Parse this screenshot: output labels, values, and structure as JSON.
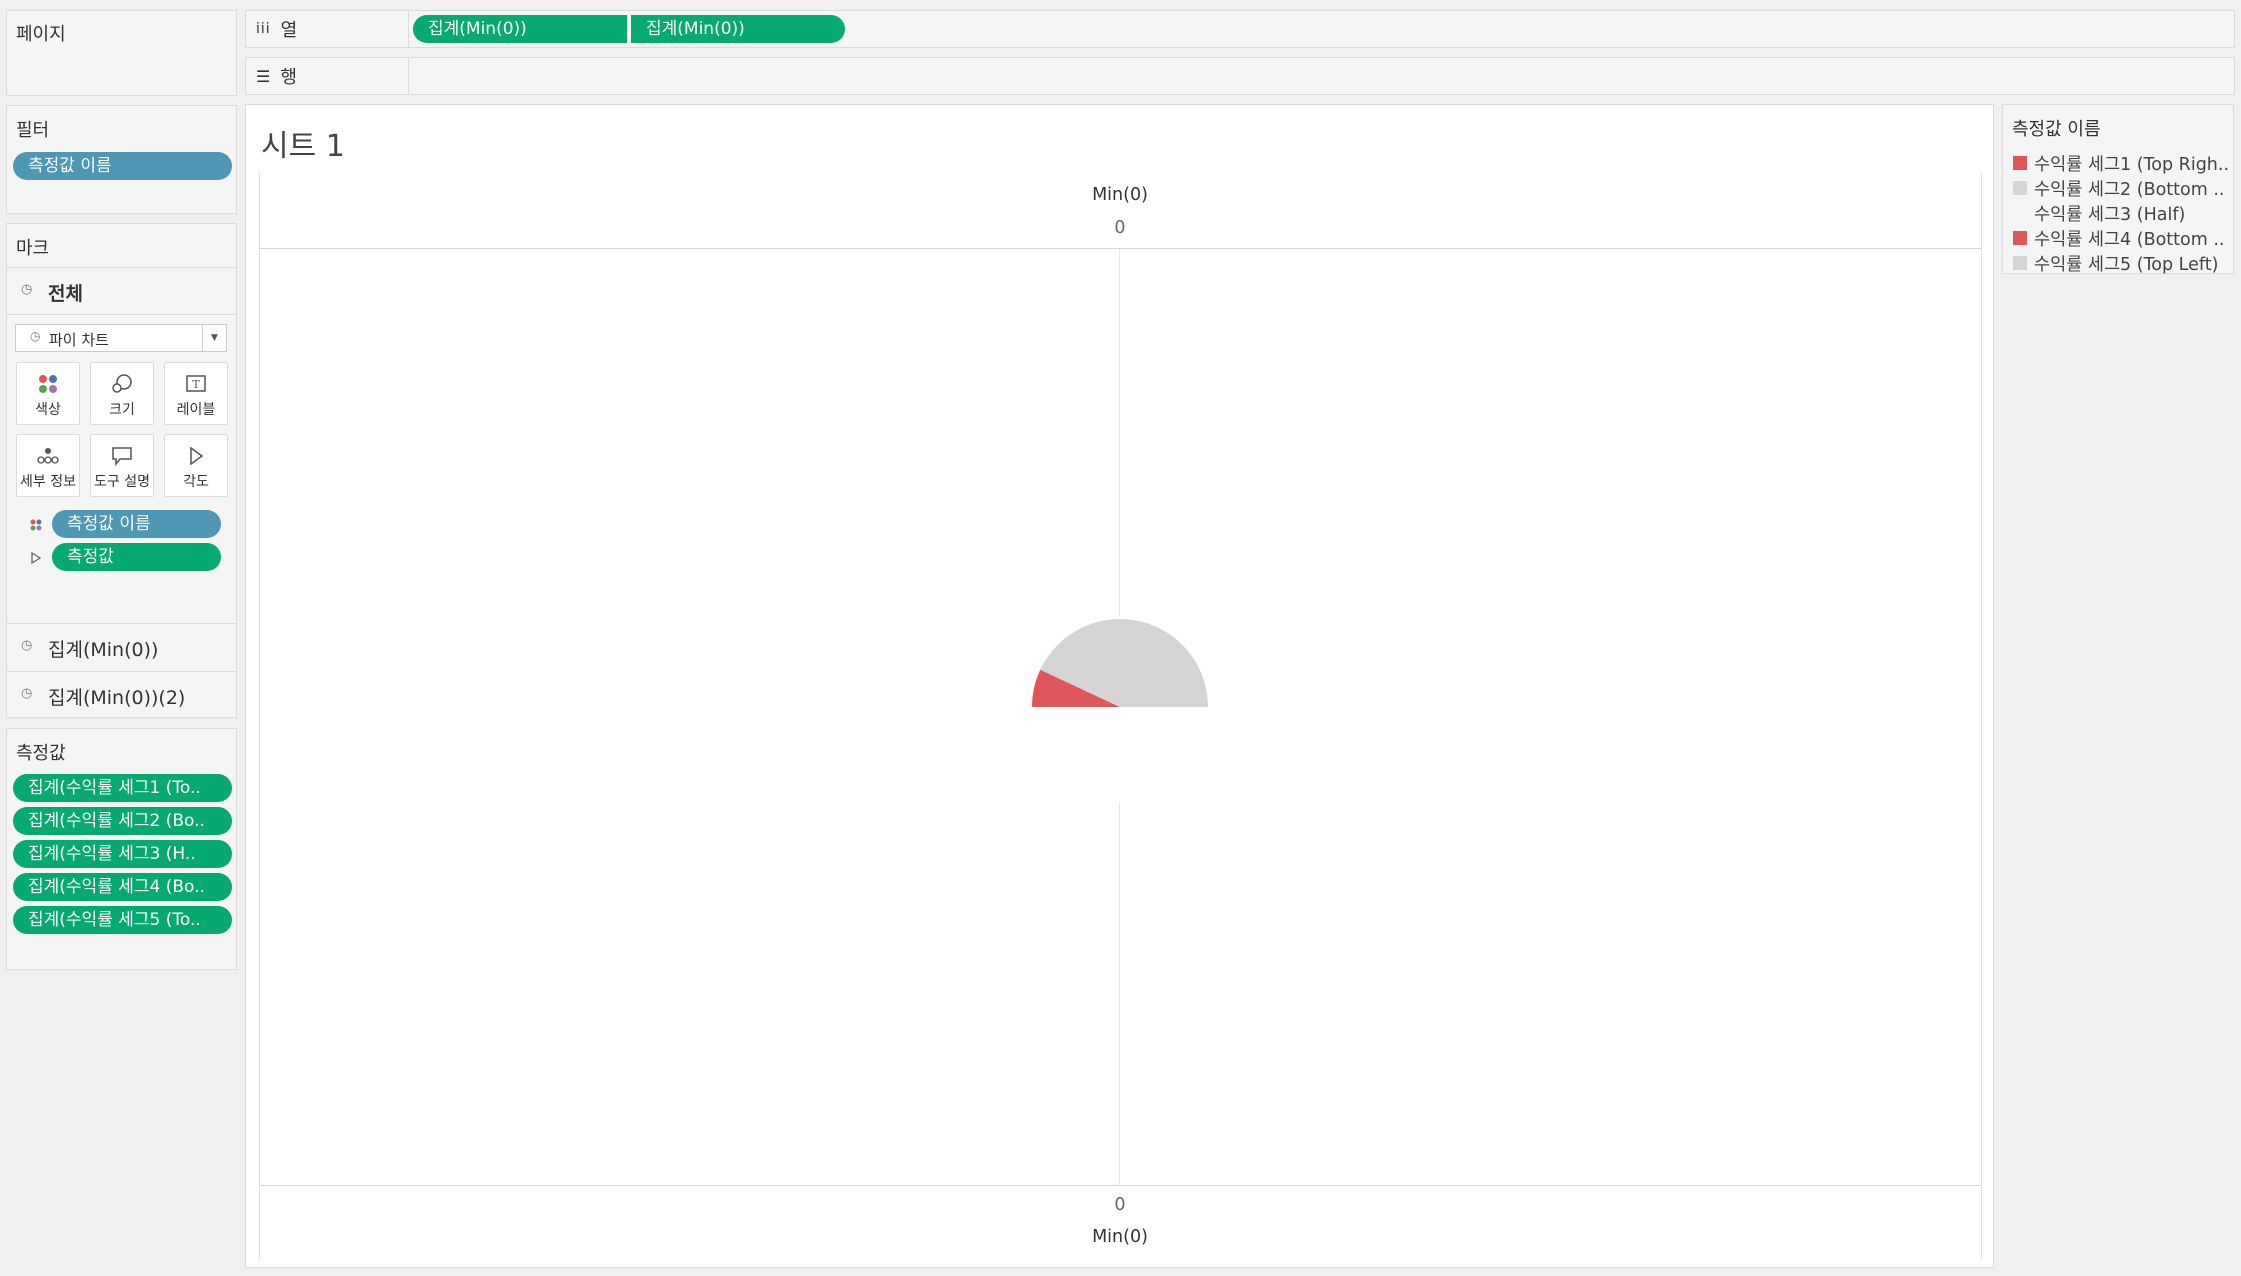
{
  "pages_shelf": {
    "title": "페이지"
  },
  "columns_shelf": {
    "label": "열",
    "pills": [
      "집계(Min(0))",
      "집계(Min(0))"
    ]
  },
  "rows_shelf": {
    "label": "행"
  },
  "filters": {
    "title": "필터",
    "pills": [
      "측정값 이름"
    ]
  },
  "marks": {
    "title": "마크",
    "sections": [
      "전체",
      "집계(Min(0))",
      "집계(Min(0))(2)"
    ],
    "mark_type": "파이 차트",
    "buttons": [
      "색상",
      "크기",
      "레이블",
      "세부 정보",
      "도구 설명",
      "각도"
    ],
    "pills": [
      {
        "label": "측정값 이름",
        "color": "#4e97b5",
        "icon": "color-dots-icon"
      },
      {
        "label": "측정값",
        "color": "#06a96f",
        "icon": "angle-icon"
      }
    ]
  },
  "measure_values": {
    "title": "측정값",
    "pills": [
      "집계(수익률 세그1 (To..",
      "집계(수익률 세그2 (Bo..",
      "집계(수익률 세그3 (H..",
      "집계(수익률 세그4 (Bo..",
      "집계(수익률 세그5 (To.."
    ]
  },
  "sheet": {
    "title": "시트 1",
    "top_axis_title": "Min(0)",
    "top_axis_tick": "0",
    "bottom_axis_tick": "0",
    "bottom_axis_title": "Min(0)"
  },
  "legend": {
    "title": "측정값 이름",
    "items": [
      {
        "label": "수익률 세그1 (Top Righ..",
        "color": "#e0575b"
      },
      {
        "label": "수익률 세그2 (Bottom ..",
        "color": "#d4d4d4"
      },
      {
        "label": "수익률 세그3 (Half)",
        "color": "none"
      },
      {
        "label": "수익률 세그4 (Bottom ..",
        "color": "#e0575b"
      },
      {
        "label": "수익률 세그5 (Top Left)",
        "color": "#d4d4d4"
      }
    ]
  },
  "colors": {
    "pill_blue": "#4e97b5",
    "pill_green": "#06a96f",
    "red": "#e0575b",
    "gray": "#d4d4d4"
  },
  "chart_data": {
    "type": "pie",
    "note_visible": "pie drawn as top half arc plus transparent half",
    "slices": [
      {
        "label": "수익률 세그1 (Top Righ..",
        "angle_deg": 25,
        "color": "#e0575b"
      },
      {
        "label": "수익률 세그2 (Bottom ..",
        "angle_deg": 155,
        "color": "#d4d4d4"
      },
      {
        "label": "수익률 세그3 (Half)",
        "angle_deg": 180,
        "color": "none"
      }
    ]
  }
}
